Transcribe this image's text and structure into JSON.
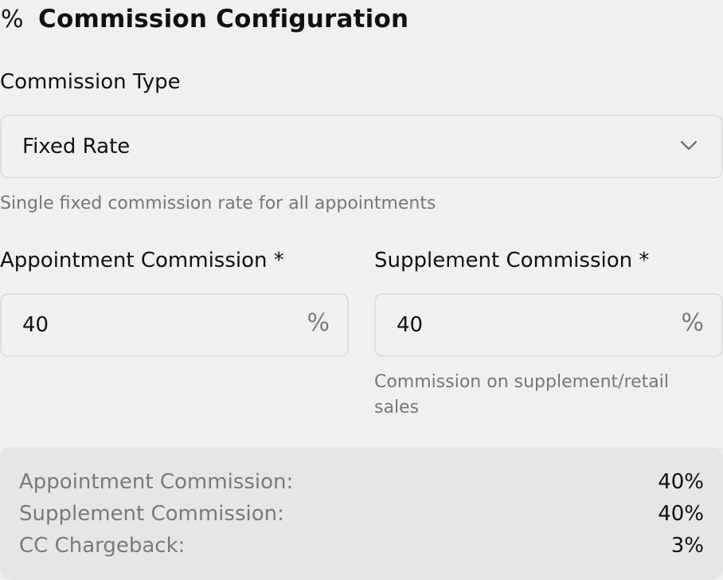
{
  "header": {
    "icon": "percent-icon",
    "icon_glyph": "%",
    "title": "Commission Configuration"
  },
  "commission_type": {
    "label": "Commission Type",
    "selected": "Fixed Rate",
    "help": "Single fixed commission rate for all appointments"
  },
  "appointment_commission": {
    "label": "Appointment Commission *",
    "value": "40",
    "unit": "%"
  },
  "supplement_commission": {
    "label": "Supplement Commission *",
    "value": "40",
    "unit": "%",
    "help": "Commission on supplement/retail sales"
  },
  "summary": {
    "rows": [
      {
        "key": "Appointment Commission:",
        "value": "40%"
      },
      {
        "key": "Supplement Commission:",
        "value": "40%"
      },
      {
        "key": "CC Chargeback:",
        "value": "3%"
      }
    ]
  },
  "colors": {
    "background": "#f0f0f0",
    "border": "#dedede",
    "muted_text": "#777777",
    "summary_bg": "#e6e6e6"
  }
}
